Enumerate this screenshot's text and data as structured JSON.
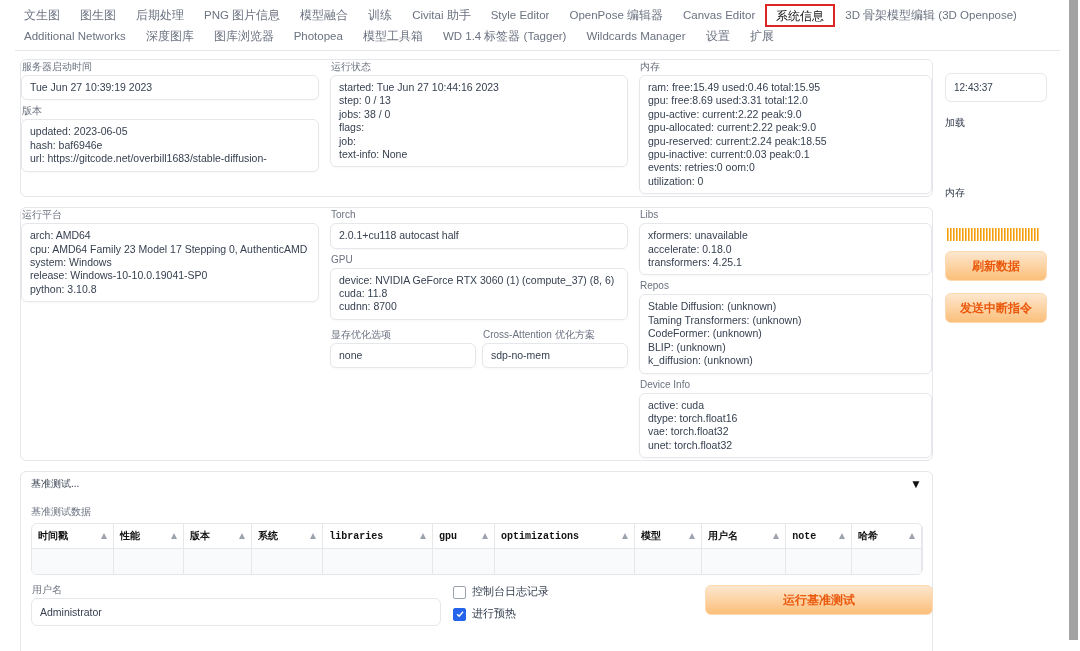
{
  "tab_rows": [
    [
      {
        "label": "文生图",
        "selected": false
      },
      {
        "label": "图生图",
        "selected": false
      },
      {
        "label": "后期处理",
        "selected": false
      },
      {
        "label": "PNG 图片信息",
        "selected": false
      },
      {
        "label": "模型融合",
        "selected": false
      },
      {
        "label": "训练",
        "selected": false
      },
      {
        "label": "Civitai 助手",
        "selected": false
      },
      {
        "label": "Style Editor",
        "selected": false
      },
      {
        "label": "OpenPose 编辑器",
        "selected": false
      },
      {
        "label": "Canvas Editor",
        "selected": false
      },
      {
        "label": "系统信息",
        "selected": true
      },
      {
        "label": "3D 骨架模型编辑 (3D Openpose)",
        "selected": false
      }
    ],
    [
      {
        "label": "Additional Networks",
        "selected": false
      },
      {
        "label": "深度图库",
        "selected": false
      },
      {
        "label": "图库浏览器",
        "selected": false
      },
      {
        "label": "Photopea",
        "selected": false
      },
      {
        "label": "模型工具箱",
        "selected": false
      },
      {
        "label": "WD 1.4 标签器 (Tagger)",
        "selected": false
      },
      {
        "label": "Wildcards Manager",
        "selected": false
      },
      {
        "label": "设置",
        "selected": false
      },
      {
        "label": "扩展",
        "selected": false
      }
    ]
  ],
  "sections": [
    {
      "columns": [
        [
          {
            "kind": "field",
            "label": "服务器启动时间",
            "lines": [
              "Tue Jun 27 10:39:19 2023"
            ]
          },
          {
            "kind": "field",
            "label": "版本",
            "lines": [
              "updated: 2023-06-05",
              "hash: baf6946e",
              "url: https://gitcode.net/overbill1683/stable-diffusion-"
            ]
          }
        ],
        [
          {
            "kind": "field",
            "label": "运行状态",
            "lines": [
              "started: Tue Jun 27 10:44:16 2023",
              "step: 0 / 13",
              "jobs: 38 / 0",
              "flags:",
              "job:",
              "text-info: None"
            ]
          }
        ],
        [
          {
            "kind": "field",
            "label": "内存",
            "lines": [
              "ram: free:15.49 used:0.46 total:15.95",
              "gpu: free:8.69 used:3.31 total:12.0",
              "gpu-active: current:2.22 peak:9.0",
              "gpu-allocated: current:2.22 peak:9.0",
              "gpu-reserved: current:2.24 peak:18.55",
              "gpu-inactive: current:0.03 peak:0.1",
              "events: retries:0 oom:0",
              "utilization: 0"
            ]
          }
        ]
      ]
    },
    {
      "columns": [
        [
          {
            "kind": "field",
            "label": "运行平台",
            "lines": [
              "arch: AMD64",
              "cpu: AMD64 Family 23 Model 17 Stepping 0, AuthenticAMD",
              "system: Windows",
              "release: Windows-10-10.0.19041-SP0",
              "python: 3.10.8"
            ]
          }
        ],
        [
          {
            "kind": "field",
            "label": "Torch",
            "lines": [
              "2.0.1+cu118 autocast  half"
            ]
          },
          {
            "kind": "field",
            "label": "GPU",
            "lines": [
              "device: NVIDIA GeForce RTX 3060 (1) (compute_37) (8, 6)",
              "cuda: 11.8",
              "cudnn: 8700"
            ]
          },
          {
            "kind": "row",
            "fields": [
              {
                "label": "显存优化选项",
                "lines": [
                  "none"
                ]
              },
              {
                "label": "Cross-Attention 优化方案",
                "lines": [
                  "sdp-no-mem"
                ]
              }
            ]
          }
        ],
        [
          {
            "kind": "field",
            "label": "Libs",
            "lines": [
              "xformers: unavailable",
              "accelerate: 0.18.0",
              "transformers: 4.25.1"
            ]
          },
          {
            "kind": "field",
            "label": "Repos",
            "lines": [
              "Stable Diffusion: (unknown)",
              "Taming Transformers: (unknown)",
              "CodeFormer: (unknown)",
              "BLIP: (unknown)",
              "k_diffusion: (unknown)"
            ]
          },
          {
            "kind": "field",
            "label": "Device Info",
            "lines": [
              "active: cuda",
              "dtype: torch.float16",
              "vae: torch.float32",
              "unet: torch.float32"
            ]
          }
        ]
      ]
    }
  ],
  "side": {
    "time": "12:43:37",
    "labels": [
      "加载",
      "内存"
    ],
    "buttons": [
      "刷新数据",
      "发送中断指令"
    ]
  },
  "benchmark": {
    "title": "基准测试...",
    "toggle": "▼",
    "expanded": true,
    "table_label": "基准测试数据",
    "columns": [
      {
        "label": "时间戳",
        "kind": "text"
      },
      {
        "label": "性能",
        "kind": "text"
      },
      {
        "label": "版本",
        "kind": "text"
      },
      {
        "label": "系统",
        "kind": "text"
      },
      {
        "label": "libraries",
        "kind": "code"
      },
      {
        "label": "gpu",
        "kind": "code"
      },
      {
        "label": "optimizations",
        "kind": "code"
      },
      {
        "label": "模型",
        "kind": "text"
      },
      {
        "label": "用户名",
        "kind": "text"
      },
      {
        "label": "note",
        "kind": "code"
      },
      {
        "label": "哈希",
        "kind": "text"
      }
    ],
    "username": {
      "label": "用户名",
      "value": "Administrator"
    },
    "checkboxes": [
      {
        "label": "控制台日志记录",
        "checked": false
      },
      {
        "label": "进行预热",
        "checked": true
      }
    ],
    "run_button": "运行基准测试"
  }
}
